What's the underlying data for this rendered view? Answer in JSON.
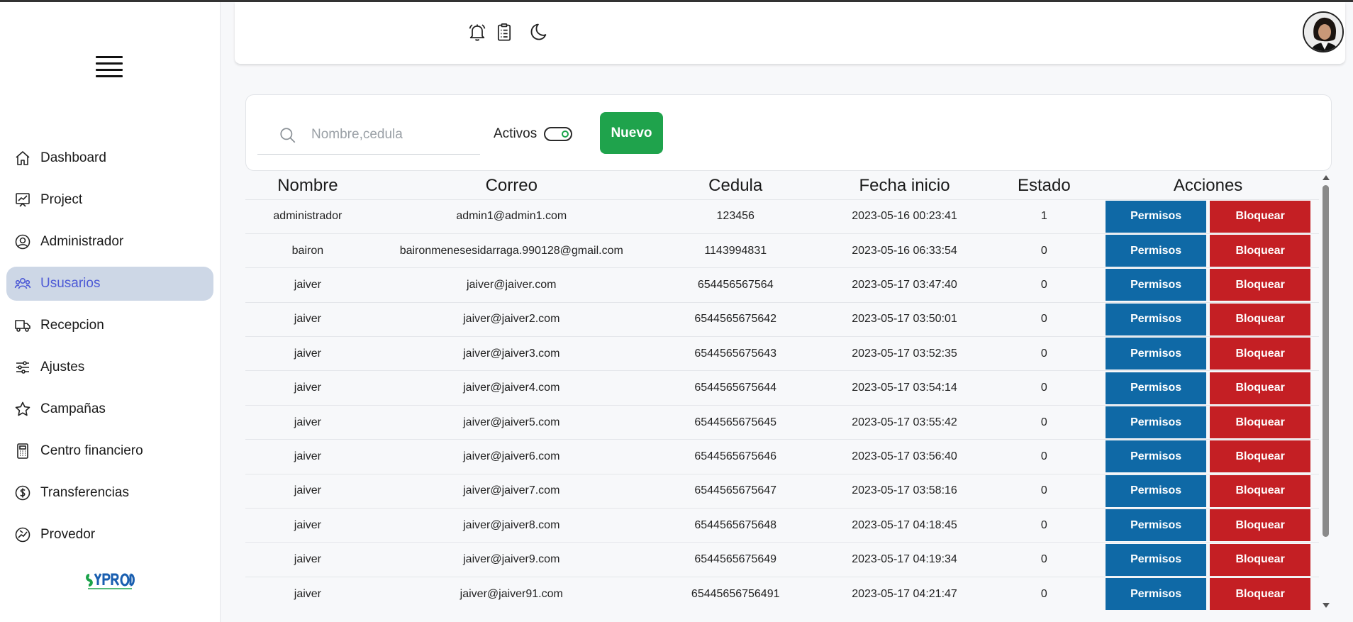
{
  "sidebar": {
    "items": [
      {
        "label": "Dashboard",
        "icon": "home-icon"
      },
      {
        "label": "Project",
        "icon": "chart-board-icon"
      },
      {
        "label": "Administrador",
        "icon": "user-circle-icon"
      },
      {
        "label": "Ususarios",
        "icon": "users-icon",
        "active": true
      },
      {
        "label": "Recepcion",
        "icon": "truck-icon"
      },
      {
        "label": "Ajustes",
        "icon": "sliders-icon"
      },
      {
        "label": "Campañas",
        "icon": "star-icon"
      },
      {
        "label": "Centro financiero",
        "icon": "calculator-icon"
      },
      {
        "label": "Transferencias",
        "icon": "dollar-circle-icon"
      },
      {
        "label": "Provedor",
        "icon": "provider-icon"
      }
    ],
    "active_color": "#4e5bd6",
    "active_bg": "#cdd7e6"
  },
  "topbar": {
    "icons": [
      "bell-icon",
      "clipboard-icon",
      "moon-icon"
    ]
  },
  "filter": {
    "search_placeholder": "Nombre,cedula",
    "activos_label": "Activos",
    "nuevo_label": "Nuevo",
    "activos_on": true
  },
  "table": {
    "headers": [
      "Nombre",
      "Correo",
      "Cedula",
      "Fecha inicio",
      "Estado",
      "Acciones"
    ],
    "permisos_label": "Permisos",
    "bloquear_label": "Bloquear",
    "rows": [
      {
        "nombre": "administrador",
        "correo": "admin1@admin1.com",
        "cedula": "123456",
        "fecha": "2023-05-16 00:23:41",
        "estado": "1"
      },
      {
        "nombre": "bairon",
        "correo": "baironmenesesidarraga.990128@gmail.com",
        "cedula": "1143994831",
        "fecha": "2023-05-16 06:33:54",
        "estado": "0"
      },
      {
        "nombre": "jaiver",
        "correo": "jaiver@jaiver.com",
        "cedula": "654456567564",
        "fecha": "2023-05-17 03:47:40",
        "estado": "0"
      },
      {
        "nombre": "jaiver",
        "correo": "jaiver@jaiver2.com",
        "cedula": "6544565675642",
        "fecha": "2023-05-17 03:50:01",
        "estado": "0"
      },
      {
        "nombre": "jaiver",
        "correo": "jaiver@jaiver3.com",
        "cedula": "6544565675643",
        "fecha": "2023-05-17 03:52:35",
        "estado": "0"
      },
      {
        "nombre": "jaiver",
        "correo": "jaiver@jaiver4.com",
        "cedula": "6544565675644",
        "fecha": "2023-05-17 03:54:14",
        "estado": "0"
      },
      {
        "nombre": "jaiver",
        "correo": "jaiver@jaiver5.com",
        "cedula": "6544565675645",
        "fecha": "2023-05-17 03:55:42",
        "estado": "0"
      },
      {
        "nombre": "jaiver",
        "correo": "jaiver@jaiver6.com",
        "cedula": "6544565675646",
        "fecha": "2023-05-17 03:56:40",
        "estado": "0"
      },
      {
        "nombre": "jaiver",
        "correo": "jaiver@jaiver7.com",
        "cedula": "6544565675647",
        "fecha": "2023-05-17 03:58:16",
        "estado": "0"
      },
      {
        "nombre": "jaiver",
        "correo": "jaiver@jaiver8.com",
        "cedula": "6544565675648",
        "fecha": "2023-05-17 04:18:45",
        "estado": "0"
      },
      {
        "nombre": "jaiver",
        "correo": "jaiver@jaiver9.com",
        "cedula": "6544565675649",
        "fecha": "2023-05-17 04:19:34",
        "estado": "0"
      },
      {
        "nombre": "jaiver",
        "correo": "jaiver@jaiver91.com",
        "cedula": "65445656756491",
        "fecha": "2023-05-17 04:21:47",
        "estado": "0"
      }
    ]
  },
  "colors": {
    "nuevo": "#1fa34c",
    "permisos": "#0f69a6",
    "bloquear": "#c41f24"
  }
}
